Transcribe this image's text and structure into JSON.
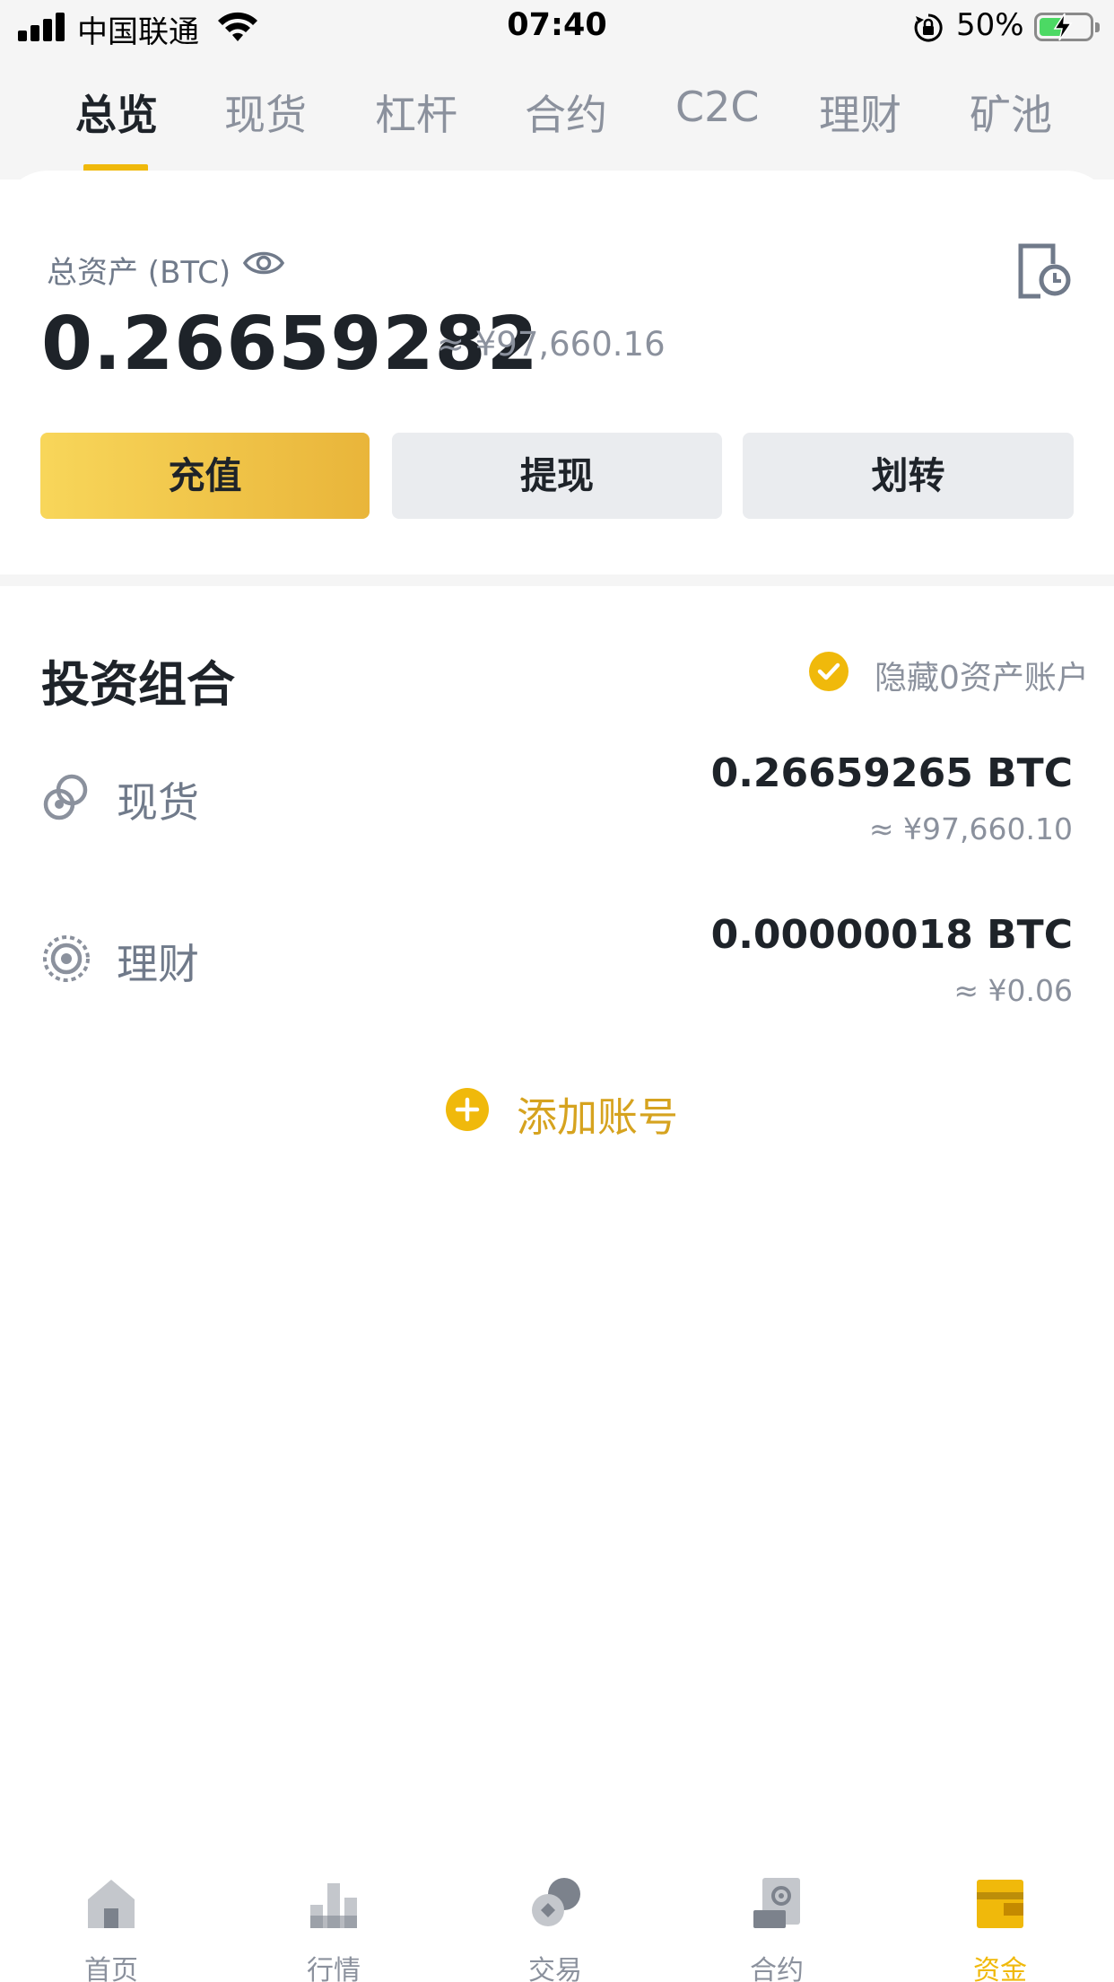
{
  "status_bar": {
    "carrier": "中国联通",
    "time": "07:40",
    "battery_percent": "50%",
    "signal_bars": 4,
    "battery_level": 0.5
  },
  "tabs": [
    {
      "label": "总览",
      "active": true
    },
    {
      "label": "现货"
    },
    {
      "label": "杠杆"
    },
    {
      "label": "合约"
    },
    {
      "label": "C2C"
    },
    {
      "label": "理财"
    },
    {
      "label": "矿池"
    }
  ],
  "overview": {
    "total_label": "总资产 (BTC)",
    "total_btc": "0.26659282",
    "total_cny": "≈ ¥97,660.16",
    "buttons": {
      "deposit": "充值",
      "withdraw": "提现",
      "transfer": "划转"
    }
  },
  "portfolio": {
    "title": "投资组合",
    "hide_zero_label": "隐藏0资产账户",
    "hide_zero_checked": true,
    "accounts": [
      {
        "name": "现货",
        "amount": "0.26659265 BTC",
        "cny": "≈ ¥97,660.10",
        "icon": "spot-icon"
      },
      {
        "name": "理财",
        "amount": "0.00000018 BTC",
        "cny": "≈ ¥0.06",
        "icon": "savings-icon"
      }
    ],
    "add_account_label": "添加账号"
  },
  "bottom_nav": [
    {
      "label": "首页",
      "icon": "home-icon"
    },
    {
      "label": "行情",
      "icon": "markets-icon"
    },
    {
      "label": "交易",
      "icon": "trade-icon"
    },
    {
      "label": "合约",
      "icon": "futures-icon"
    },
    {
      "label": "资金",
      "icon": "wallet-icon",
      "active": true
    }
  ],
  "colors": {
    "accent": "#f0b90b",
    "text_primary": "#1e2329",
    "text_secondary": "#8b919d",
    "button_bg": "#eaecef"
  }
}
